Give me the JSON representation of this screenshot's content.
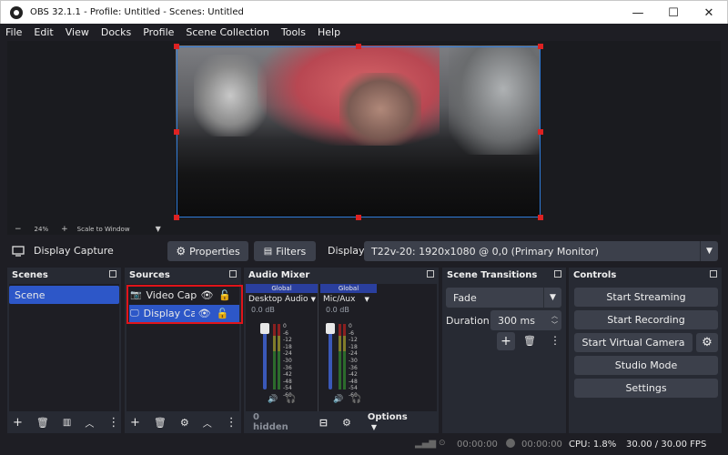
{
  "titlebar": {
    "title": "OBS 32.1.1 - Profile: Untitled - Scenes: Untitled",
    "minimize": "—",
    "maximize": "☐",
    "close": "✕"
  },
  "menu": [
    "File",
    "Edit",
    "View",
    "Docks",
    "Profile",
    "Scene Collection",
    "Tools",
    "Help"
  ],
  "zoombar": {
    "minus": "−",
    "zoom": "24%",
    "plus": "+",
    "scale_label": "Scale to Window"
  },
  "context": {
    "source_name": "Display Capture",
    "properties": "Properties",
    "filters": "Filters",
    "display_label": "Display",
    "display_value": "T22v-20: 1920x1080 @ 0,0 (Primary Monitor)"
  },
  "scenes": {
    "title": "Scenes",
    "items": [
      "Scene"
    ]
  },
  "sources": {
    "title": "Sources",
    "items": [
      "Video Cap",
      "Display Ca"
    ]
  },
  "mixer": {
    "title": "Audio Mixer",
    "channels": [
      {
        "badge": "Global",
        "name": "Desktop Audio",
        "db": "0.0 dB"
      },
      {
        "badge": "Global",
        "name": "Mic/Aux",
        "db": "0.0 dB"
      }
    ],
    "scale": [
      "0",
      "-6",
      "-12",
      "-18",
      "-24",
      "-30",
      "-36",
      "-42",
      "-48",
      "-54",
      "-60"
    ],
    "hidden": "0 hidden",
    "options": "Options"
  },
  "transitions": {
    "title": "Scene Transitions",
    "type": "Fade",
    "duration_label": "Duration",
    "duration_value": "300 ms"
  },
  "controls": {
    "title": "Controls",
    "start_streaming": "Start Streaming",
    "start_recording": "Start Recording",
    "start_virtual_camera": "Start Virtual Camera",
    "studio_mode": "Studio Mode",
    "settings": "Settings"
  },
  "status": {
    "stream_time": "00:00:00",
    "record_time": "00:00:00",
    "cpu": "CPU: 1.8%",
    "fps": "30.00 / 30.00 FPS"
  },
  "colors": {
    "accent_blue": "#2f7bd8",
    "highlight_red": "#e0141a",
    "selected_item": "#2d57c8"
  }
}
